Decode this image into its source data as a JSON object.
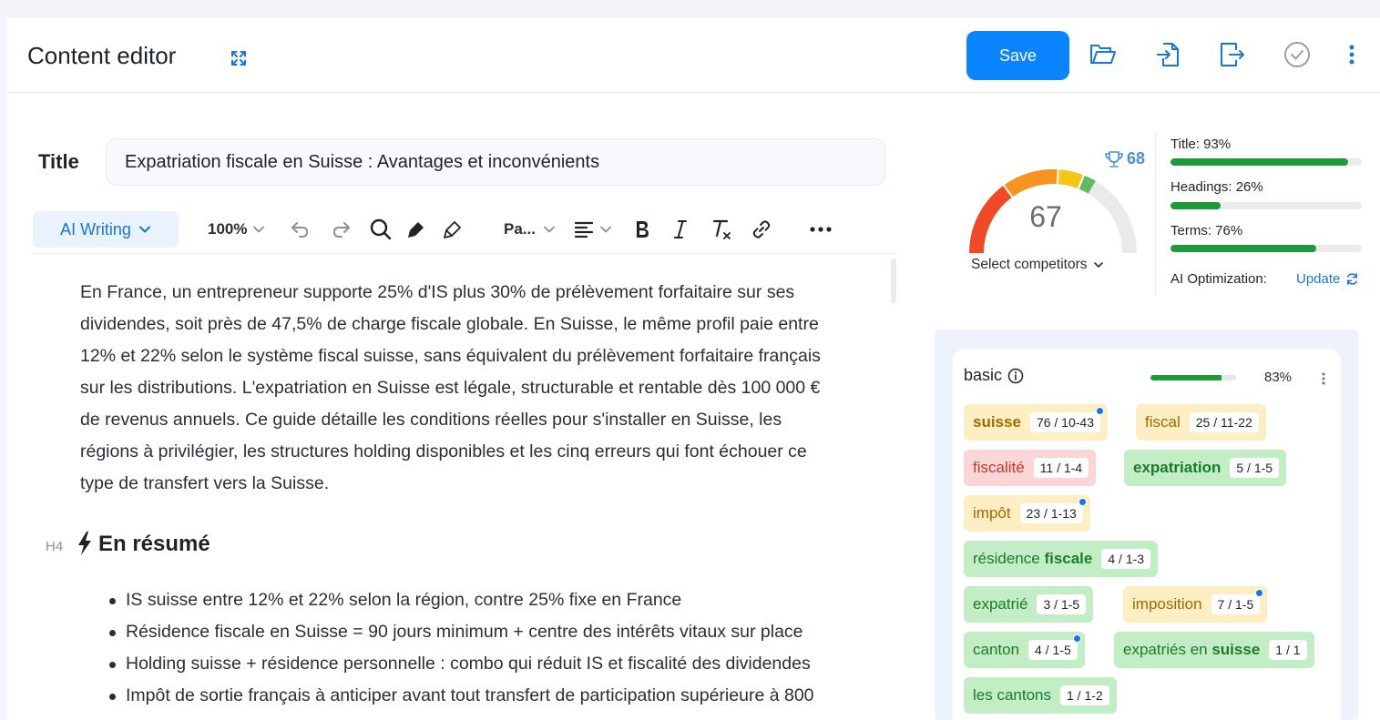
{
  "header": {
    "title": "Content editor",
    "save_label": "Save"
  },
  "title_field": {
    "label": "Title",
    "value": "Expatriation fiscale en Suisse : Avantages et inconvénients"
  },
  "toolbar": {
    "ai_writing": "AI Writing",
    "zoom": "100%",
    "paragraph": "Pa..."
  },
  "editor": {
    "paragraph_lines": [
      "En France, un entrepreneur supporte 25% d'IS plus 30% de prélèvement forfaitaire sur ses",
      "dividendes, soit près de 47,5% de charge fiscale globale. En Suisse, le même profil paie entre",
      "12% et 22% selon le système fiscal suisse, sans équivalent du prélèvement forfaitaire français",
      "sur les distributions. L'expatriation en Suisse est légale, structurable et rentable dès 100 000 €",
      "de revenus annuels. Ce guide détaille les conditions réelles pour s'installer en Suisse, les",
      "régions à privilégier, les structures holding disponibles et les cinq erreurs qui font échouer ce",
      "type de transfert vers la Suisse."
    ],
    "heading_tag": "H4",
    "heading": "En résumé",
    "bullets": [
      "IS suisse entre 12% et 22% selon la région, contre 25% fixe en France",
      "Résidence fiscale en Suisse = 90 jours minimum + centre des intérêts vitaux sur place",
      "Holding suisse + résidence personnelle : combo qui réduit IS et fiscalité des dividendes",
      "Impôt de sortie français à anticiper avant tout transfert de participation supérieure à 800"
    ]
  },
  "score": {
    "value": "67",
    "score_fraction": 0.67,
    "target": "68",
    "select_competitors": "Select competitors",
    "metrics": [
      {
        "label": "Title: 93%",
        "percent": 93
      },
      {
        "label": "Headings: 26%",
        "percent": 26
      },
      {
        "label": "Terms: 76%",
        "percent": 76
      }
    ],
    "ai_optimization_label": "AI Optimization:",
    "update_label": "Update"
  },
  "terms": {
    "group_label": "basic",
    "group_percent": "83%",
    "group_fraction": 0.83,
    "chips": [
      {
        "label": "suisse",
        "count": "76  /  10-43",
        "color": "yellow",
        "bold": true,
        "dot": true
      },
      {
        "label": "fiscal",
        "count": "25  /  11-22",
        "color": "yellow",
        "bold": false,
        "dot": false
      },
      {
        "label": "fiscalité",
        "count": "11  /  1-4",
        "color": "red",
        "bold": false,
        "dot": false
      },
      {
        "label": "expatriation",
        "count": "5  /  1-5",
        "color": "green",
        "bold": true,
        "dot": false
      },
      {
        "label": "impôt",
        "count": "23  /  1-13",
        "color": "yellow",
        "bold": false,
        "dot": true
      },
      {
        "label_parts": [
          "résidence ",
          "fiscale"
        ],
        "count": "4  /  1-3",
        "color": "green",
        "dot": false
      },
      {
        "label": "expatrié",
        "count": "3  /  1-5",
        "color": "green",
        "bold": false,
        "dot": false
      },
      {
        "label": "imposition",
        "count": "7  /  1-5",
        "color": "yellow",
        "bold": false,
        "dot": true
      },
      {
        "label": "canton",
        "count": "4  /  1-5",
        "color": "green",
        "bold": false,
        "dot": true
      },
      {
        "label_parts": [
          "expatriés en ",
          "suisse"
        ],
        "count": "1  /  1",
        "color": "green",
        "dot": false
      },
      {
        "label": "les cantons",
        "count": "1  /  1-2",
        "color": "green",
        "bold": false,
        "dot": false
      }
    ]
  }
}
